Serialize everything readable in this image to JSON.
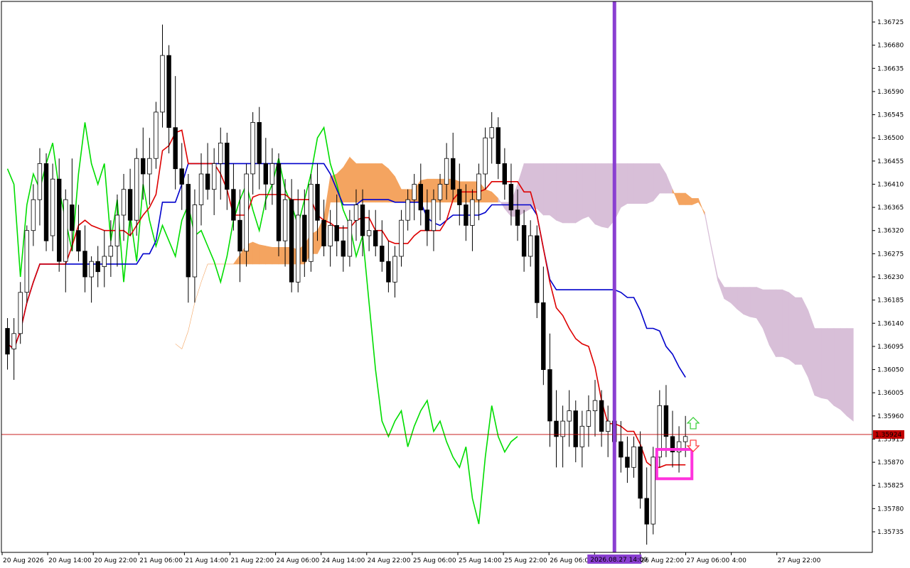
{
  "chart_data": {
    "type": "candlestick",
    "instrument_timeframe": "1h",
    "price_axis": {
      "ticks": [
        "1.36725",
        "1.36680",
        "1.36635",
        "1.36590",
        "1.36545",
        "1.36500",
        "1.36455",
        "1.36410",
        "1.36365",
        "1.36320",
        "1.36275",
        "1.36230",
        "1.36185",
        "1.36140",
        "1.36095",
        "1.36050",
        "1.36005",
        "1.35960",
        "1.35915",
        "1.35870",
        "1.35825",
        "1.35780",
        "1.35735"
      ],
      "ylim": [
        1.35695,
        1.36765
      ]
    },
    "time_axis": {
      "ticks": [
        "20 Aug 2026",
        "20 Aug 14:00",
        "20 Aug 22:00",
        "21 Aug 06:00",
        "21 Aug 14:00",
        "21 Aug 22:00",
        "24 Aug 06:00",
        "24 Aug 14:00",
        "24 Aug 22:00",
        "25 Aug 06:00",
        "25 Aug 14:00",
        "25 Aug 22:00",
        "26 Aug 06:00",
        "26 Aug 14:00",
        "26 Aug 22:00",
        "27 Aug 06:00",
        "4:00",
        "27 Aug 22:00"
      ],
      "cursor_label": "2026.08.27 14:00"
    },
    "current_price": {
      "value": 1.35924,
      "label": "1.35924",
      "color": "#c00000"
    },
    "vertical_marker": {
      "color": "#8a3fd1"
    },
    "highlight_box": {
      "color": "#ff33dd",
      "price_top": 1.35895,
      "price_bottom": 1.35838
    },
    "arrows": {
      "up_color": "#33cc33",
      "down_color": "#ff3333"
    },
    "colors": {
      "tenkan": "#dd0000",
      "kijun": "#0000cc",
      "chikou": "#00dd00",
      "kumo_bullish": "#f4a460",
      "kumo_bearish": "#d8bfd8",
      "candle_bull": "#ffffff",
      "candle_bear": "#000000"
    },
    "candles": [
      [
        1.3613,
        1.3615,
        1.3605,
        1.3608
      ],
      [
        1.3609,
        1.3615,
        1.3603,
        1.3612
      ],
      [
        1.3612,
        1.3622,
        1.361,
        1.362
      ],
      [
        1.362,
        1.3633,
        1.3618,
        1.3632
      ],
      [
        1.3632,
        1.3641,
        1.3629,
        1.3638
      ],
      [
        1.3638,
        1.3648,
        1.3633,
        1.3645
      ],
      [
        1.3645,
        1.3647,
        1.3628,
        1.363
      ],
      [
        1.3631,
        1.3645,
        1.3628,
        1.3642
      ],
      [
        1.3642,
        1.3646,
        1.3624,
        1.3626
      ],
      [
        1.3626,
        1.364,
        1.362,
        1.3638
      ],
      [
        1.3637,
        1.3646,
        1.3628,
        1.3632
      ],
      [
        1.3632,
        1.3637,
        1.3626,
        1.3628
      ],
      [
        1.3628,
        1.3633,
        1.362,
        1.3623
      ],
      [
        1.3623,
        1.3627,
        1.3618,
        1.3626
      ],
      [
        1.3626,
        1.3629,
        1.3621,
        1.3624
      ],
      [
        1.3625,
        1.3632,
        1.3621,
        1.3627
      ],
      [
        1.3627,
        1.3634,
        1.3623,
        1.3629
      ],
      [
        1.3629,
        1.3639,
        1.3625,
        1.3635
      ],
      [
        1.3635,
        1.3643,
        1.363,
        1.364
      ],
      [
        1.364,
        1.3644,
        1.3631,
        1.3634
      ],
      [
        1.3634,
        1.3648,
        1.3631,
        1.3646
      ],
      [
        1.3646,
        1.3652,
        1.3638,
        1.3643
      ],
      [
        1.3643,
        1.365,
        1.3637,
        1.3646
      ],
      [
        1.3646,
        1.3657,
        1.3644,
        1.3655
      ],
      [
        1.3655,
        1.3672,
        1.3652,
        1.3666
      ],
      [
        1.3666,
        1.3668,
        1.3647,
        1.3652
      ],
      [
        1.3652,
        1.3662,
        1.364,
        1.3644
      ],
      [
        1.3644,
        1.3649,
        1.3636,
        1.3641
      ],
      [
        1.3641,
        1.3643,
        1.3618,
        1.3623
      ],
      [
        1.3623,
        1.364,
        1.3618,
        1.3637
      ],
      [
        1.3637,
        1.3647,
        1.3633,
        1.3643
      ],
      [
        1.3643,
        1.3649,
        1.3638,
        1.364
      ],
      [
        1.364,
        1.3648,
        1.3635,
        1.3645
      ],
      [
        1.3645,
        1.3652,
        1.3638,
        1.3649
      ],
      [
        1.3649,
        1.3651,
        1.3636,
        1.364
      ],
      [
        1.364,
        1.3645,
        1.3632,
        1.3634
      ],
      [
        1.3634,
        1.364,
        1.3622,
        1.3628
      ],
      [
        1.3628,
        1.3645,
        1.3625,
        1.3643
      ],
      [
        1.3643,
        1.3655,
        1.3639,
        1.3653
      ],
      [
        1.3653,
        1.3656,
        1.364,
        1.3645
      ],
      [
        1.3645,
        1.365,
        1.3636,
        1.3641
      ],
      [
        1.3641,
        1.3648,
        1.3637,
        1.3645
      ],
      [
        1.3645,
        1.3647,
        1.3627,
        1.363
      ],
      [
        1.363,
        1.3642,
        1.3625,
        1.3638
      ],
      [
        1.3638,
        1.3642,
        1.362,
        1.3622
      ],
      [
        1.3622,
        1.364,
        1.362,
        1.3635
      ],
      [
        1.3635,
        1.364,
        1.3623,
        1.3626
      ],
      [
        1.3626,
        1.3643,
        1.3624,
        1.3641
      ],
      [
        1.3641,
        1.3645,
        1.363,
        1.3634
      ],
      [
        1.3634,
        1.3638,
        1.3627,
        1.3629
      ],
      [
        1.3629,
        1.3636,
        1.3625,
        1.3633
      ],
      [
        1.3633,
        1.3639,
        1.3627,
        1.363
      ],
      [
        1.363,
        1.3633,
        1.3624,
        1.3627
      ],
      [
        1.3627,
        1.3636,
        1.3625,
        1.3634
      ],
      [
        1.3634,
        1.364,
        1.363,
        1.3637
      ],
      [
        1.3637,
        1.364,
        1.3627,
        1.3631
      ],
      [
        1.3631,
        1.3636,
        1.3628,
        1.3632
      ],
      [
        1.3632,
        1.3636,
        1.3627,
        1.3629
      ],
      [
        1.3629,
        1.3634,
        1.3624,
        1.3626
      ],
      [
        1.3626,
        1.363,
        1.362,
        1.3622
      ],
      [
        1.3622,
        1.3629,
        1.3619,
        1.3627
      ],
      [
        1.3627,
        1.3636,
        1.3625,
        1.3634
      ],
      [
        1.3634,
        1.364,
        1.3632,
        1.3638
      ],
      [
        1.3638,
        1.3643,
        1.3634,
        1.3641
      ],
      [
        1.3641,
        1.3645,
        1.3633,
        1.3636
      ],
      [
        1.3636,
        1.364,
        1.3629,
        1.3632
      ],
      [
        1.3632,
        1.364,
        1.3628,
        1.3638
      ],
      [
        1.3638,
        1.3643,
        1.3634,
        1.3641
      ],
      [
        1.3641,
        1.3649,
        1.3638,
        1.3646
      ],
      [
        1.3646,
        1.3651,
        1.3638,
        1.364
      ],
      [
        1.364,
        1.3645,
        1.3633,
        1.3637
      ],
      [
        1.3637,
        1.3641,
        1.363,
        1.3633
      ],
      [
        1.3633,
        1.364,
        1.3628,
        1.3638
      ],
      [
        1.3638,
        1.3645,
        1.3634,
        1.3643
      ],
      [
        1.3643,
        1.3652,
        1.364,
        1.365
      ],
      [
        1.365,
        1.3655,
        1.3645,
        1.3652
      ],
      [
        1.3652,
        1.3654,
        1.3642,
        1.3645
      ],
      [
        1.3645,
        1.3648,
        1.3638,
        1.3641
      ],
      [
        1.3641,
        1.3645,
        1.3633,
        1.3636
      ],
      [
        1.3636,
        1.364,
        1.363,
        1.3633
      ],
      [
        1.3633,
        1.3636,
        1.3624,
        1.3627
      ],
      [
        1.3627,
        1.3634,
        1.3625,
        1.3631
      ],
      [
        1.3631,
        1.3633,
        1.3615,
        1.3618
      ],
      [
        1.3618,
        1.3625,
        1.3602,
        1.3605
      ],
      [
        1.3605,
        1.3612,
        1.359,
        1.3595
      ],
      [
        1.3595,
        1.3601,
        1.3586,
        1.3592
      ],
      [
        1.3592,
        1.3598,
        1.3586,
        1.3595
      ],
      [
        1.3595,
        1.3601,
        1.359,
        1.3597
      ],
      [
        1.3597,
        1.3599,
        1.3587,
        1.359
      ],
      [
        1.359,
        1.3597,
        1.3586,
        1.3594
      ],
      [
        1.3594,
        1.36,
        1.359,
        1.3597
      ],
      [
        1.3597,
        1.3603,
        1.3592,
        1.3599
      ],
      [
        1.3599,
        1.3601,
        1.359,
        1.3593
      ],
      [
        1.3593,
        1.3598,
        1.3588,
        1.3595
      ],
      [
        1.3595,
        1.36,
        1.3589,
        1.3591
      ],
      [
        1.3591,
        1.3595,
        1.3585,
        1.3588
      ],
      [
        1.3588,
        1.3592,
        1.3583,
        1.3586
      ],
      [
        1.3586,
        1.3592,
        1.3584,
        1.359
      ],
      [
        1.359,
        1.3593,
        1.3578,
        1.358
      ],
      [
        1.358,
        1.3586,
        1.3571,
        1.3575
      ],
      [
        1.3575,
        1.359,
        1.3573,
        1.3588
      ],
      [
        1.3588,
        1.3601,
        1.3586,
        1.3598
      ],
      [
        1.3598,
        1.3602,
        1.3588,
        1.3592
      ],
      [
        1.3592,
        1.3597,
        1.3586,
        1.3589
      ],
      [
        1.3589,
        1.3594,
        1.3585,
        1.3591
      ],
      [
        1.3591,
        1.3596,
        1.3588,
        1.3592
      ]
    ]
  }
}
